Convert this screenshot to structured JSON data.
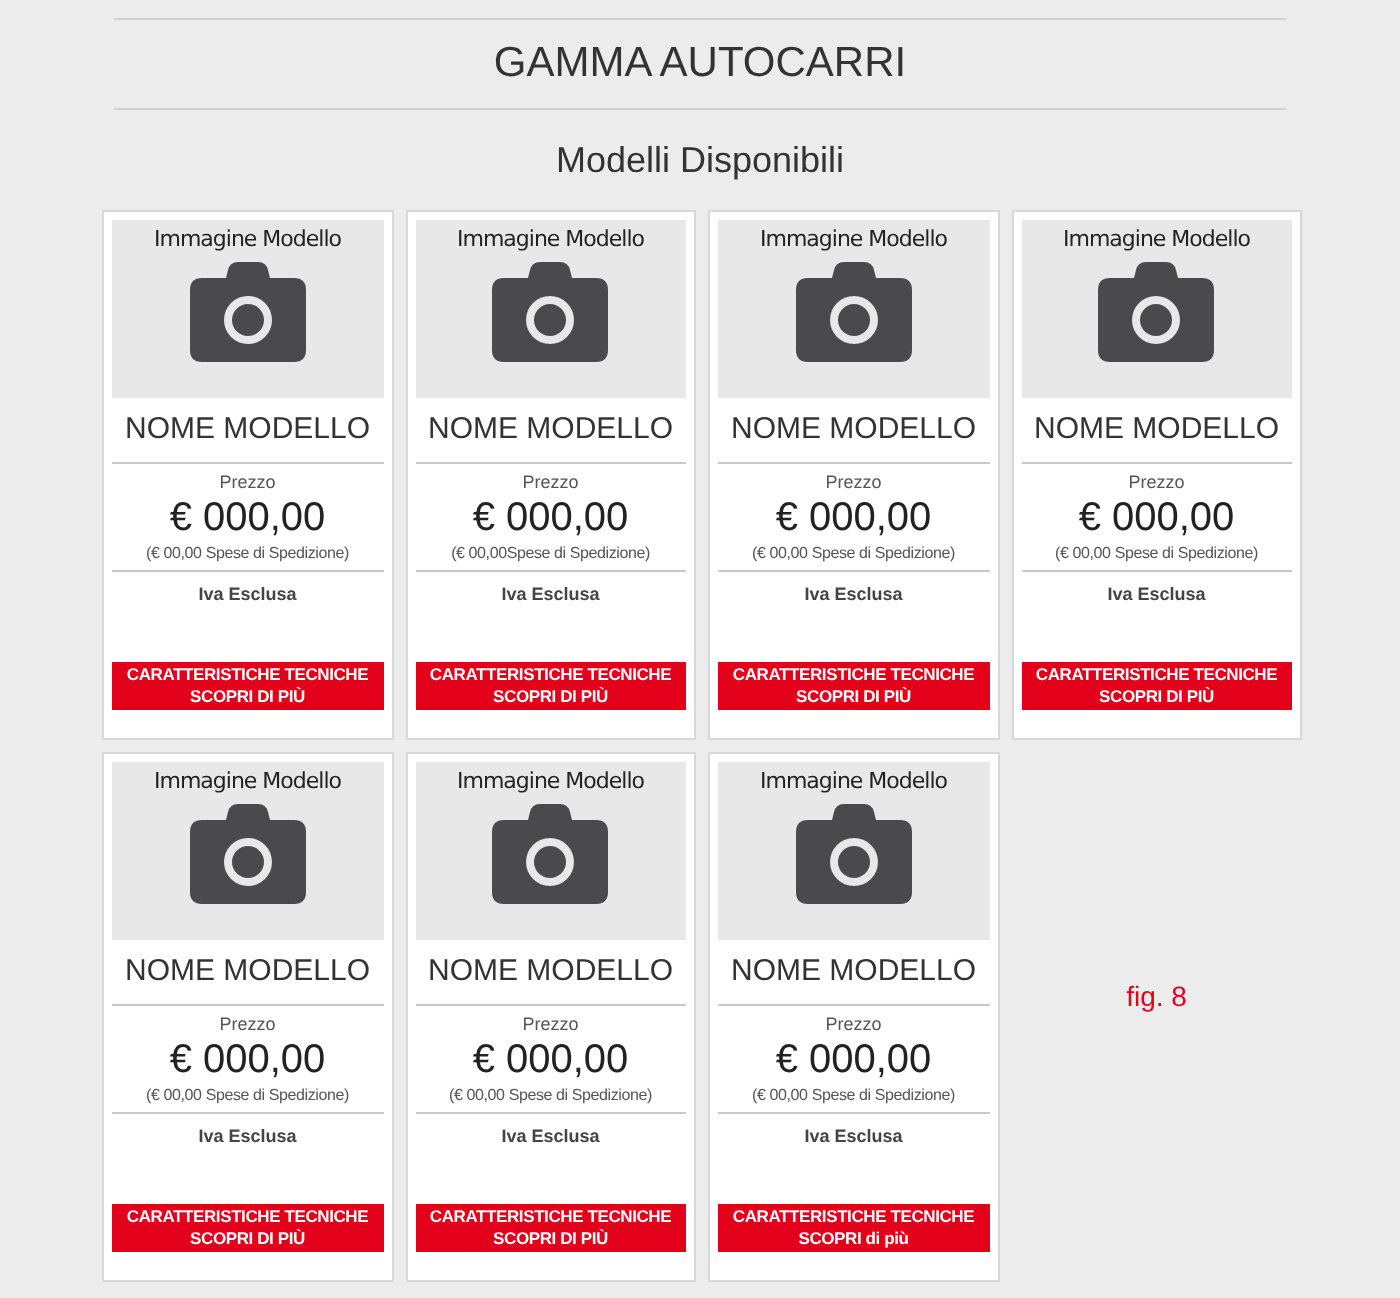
{
  "title": "GAMMA AUTOCARRI",
  "subtitle": "Modelli Disponibili",
  "cards": [
    {
      "image_caption": "Immagine Modello",
      "name": "NOME MODELLO",
      "price_label": "Prezzo",
      "price": "€ 000,00",
      "shipping": "(€ 00,00 Spese di Spedizione)",
      "tax": "Iva Esclusa",
      "button_line_1": "CARATTERISTICHE TECNICHE",
      "button_line_2": "SCOPRI DI PIÙ"
    },
    {
      "image_caption": "Immagine Modello",
      "name": "NOME MODELLO",
      "price_label": "Prezzo",
      "price": "€ 000,00",
      "shipping": "(€ 00,00Spese di Spedizione)",
      "tax": "Iva Esclusa",
      "button_line_1": "CARATTERISTICHE TECNICHE",
      "button_line_2": "SCOPRI DI PIÙ"
    },
    {
      "image_caption": "Immagine Modello",
      "name": "NOME MODELLO",
      "price_label": "Prezzo",
      "price": "€ 000,00",
      "shipping": "(€ 00,00 Spese di Spedizione)",
      "tax": "Iva Esclusa",
      "button_line_1": "CARATTERISTICHE TECNICHE",
      "button_line_2": "SCOPRI DI PIÙ"
    },
    {
      "image_caption": "Immagine Modello",
      "name": "NOME MODELLO",
      "price_label": "Prezzo",
      "price": "€ 000,00",
      "shipping": "(€ 00,00 Spese di Spedizione)",
      "tax": "Iva Esclusa",
      "button_line_1": "CARATTERISTICHE TECNICHE",
      "button_line_2": "SCOPRI DI PIÙ"
    },
    {
      "image_caption": "Immagine Modello",
      "name": "NOME MODELLO",
      "price_label": "Prezzo",
      "price": "€ 000,00",
      "shipping": "(€ 00,00 Spese di Spedizione)",
      "tax": "Iva Esclusa",
      "button_line_1": "CARATTERISTICHE TECNICHE",
      "button_line_2": "SCOPRI DI PIÙ"
    },
    {
      "image_caption": "Immagine Modello",
      "name": "NOME MODELLO",
      "price_label": "Prezzo",
      "price": "€ 000,00",
      "shipping": "(€ 00,00 Spese di Spedizione)",
      "tax": "Iva Esclusa",
      "button_line_1": "CARATTERISTICHE TECNICHE",
      "button_line_2": "SCOPRI DI PIÙ"
    },
    {
      "image_caption": "Immagine Modello",
      "name": "NOME MODELLO",
      "price_label": "Prezzo",
      "price": "€ 000,00",
      "shipping": "(€ 00,00 Spese di Spedizione)",
      "tax": "Iva Esclusa",
      "button_line_1": "CARATTERISTICHE TECNICHE",
      "button_line_2": "SCOPRI di più"
    }
  ],
  "figure_label": "fig. 8"
}
